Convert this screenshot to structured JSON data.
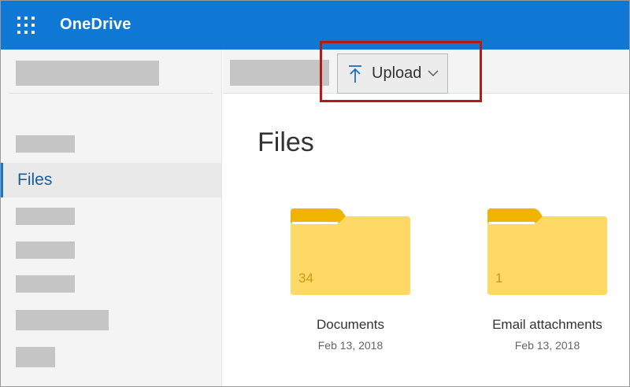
{
  "app": {
    "title": "OneDrive",
    "accent_color": "#0f78d4",
    "launcher_icon": "waffle-icon"
  },
  "sidebar": {
    "selected_item": "Files"
  },
  "command_bar": {
    "upload_label": "Upload",
    "upload_icon": "upload-arrow-icon",
    "upload_dropdown_icon": "chevron-down-icon",
    "highlight_color": "#b31b1b"
  },
  "main": {
    "title": "Files",
    "folders": [
      {
        "name": "Documents",
        "count": "34",
        "date": "Feb 13, 2018"
      },
      {
        "name": "Email attachments",
        "count": "1",
        "date": "Feb 13, 2018"
      }
    ],
    "folder_color": "#ffd966"
  }
}
